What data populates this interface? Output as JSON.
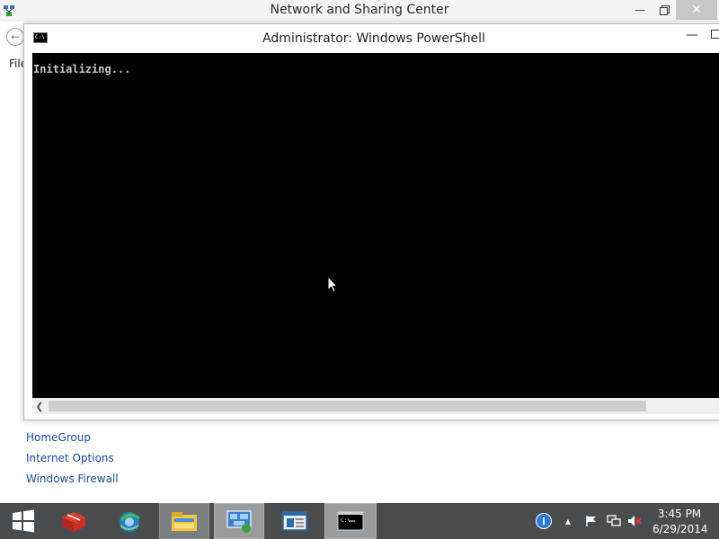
{
  "background_window": {
    "title": "Network and Sharing Center",
    "menu_file": "File",
    "links": [
      "HomeGroup",
      "Internet Options",
      "Windows Firewall"
    ]
  },
  "powershell": {
    "title": "Administrator: Windows PowerShell",
    "console_text": "Initializing...",
    "console_bg": "#000000",
    "console_fg": "#c8c8c8"
  },
  "taskbar": {
    "time": "3:45 PM",
    "date": "6/29/2014",
    "pinned": [
      "start-icon",
      "redbox-app-icon",
      "ie-globe-icon",
      "file-explorer-icon",
      "network-sharing-icon",
      "document-window-icon",
      "powershell-icon"
    ]
  },
  "colors": {
    "taskbar": "#4a4d4f",
    "link": "#1a4a9c"
  }
}
